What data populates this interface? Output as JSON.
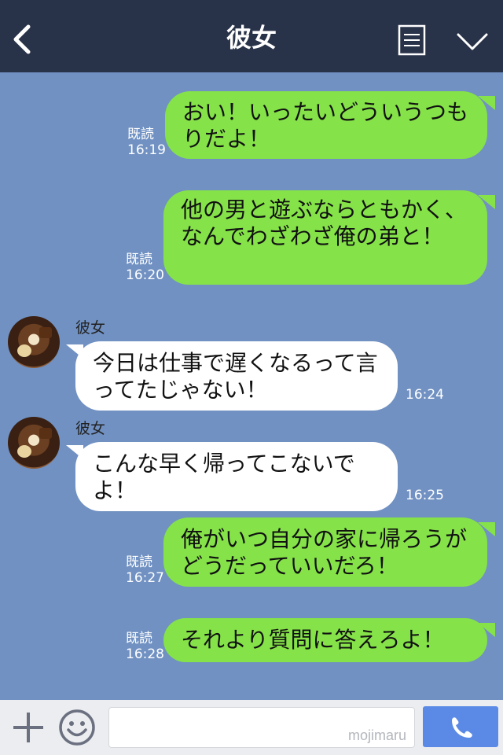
{
  "header": {
    "title": "彼女",
    "back_icon": "chevron-left-icon",
    "menu_icon": "note-icon",
    "dropdown_icon": "chevron-down-icon"
  },
  "messages": [
    {
      "from": "me",
      "text": "おい！いったいどういうつもりだよ！",
      "read": "既読",
      "time": "16:19"
    },
    {
      "from": "me",
      "text": "他の男と遊ぶならともかく、なんでわざわざ俺の弟と！",
      "read": "既読",
      "time": "16:20"
    },
    {
      "from": "them",
      "sender": "彼女",
      "text": "今日は仕事で遅くなるって言ってたじゃない！",
      "time": "16:24"
    },
    {
      "from": "them",
      "sender": "彼女",
      "text": "こんな早く帰ってこないでよ！",
      "time": "16:25"
    },
    {
      "from": "me",
      "text": "俺がいつ自分の家に帰ろうがどうだっていいだろ！",
      "read": "既読",
      "time": "16:27"
    },
    {
      "from": "me",
      "text": "それより質問に答えろよ！",
      "read": "既読",
      "time": "16:28"
    }
  ],
  "footer": {
    "input_value": "",
    "watermark": "mojimaru",
    "plus_icon": "plus-icon",
    "emoji_icon": "smiley-icon",
    "call_icon": "phone-icon"
  },
  "colors": {
    "header_bg": "#283248",
    "chat_bg": "#7091c2",
    "my_bubble": "#85e249",
    "their_bubble": "#ffffff",
    "call_button": "#5b8ae6"
  }
}
